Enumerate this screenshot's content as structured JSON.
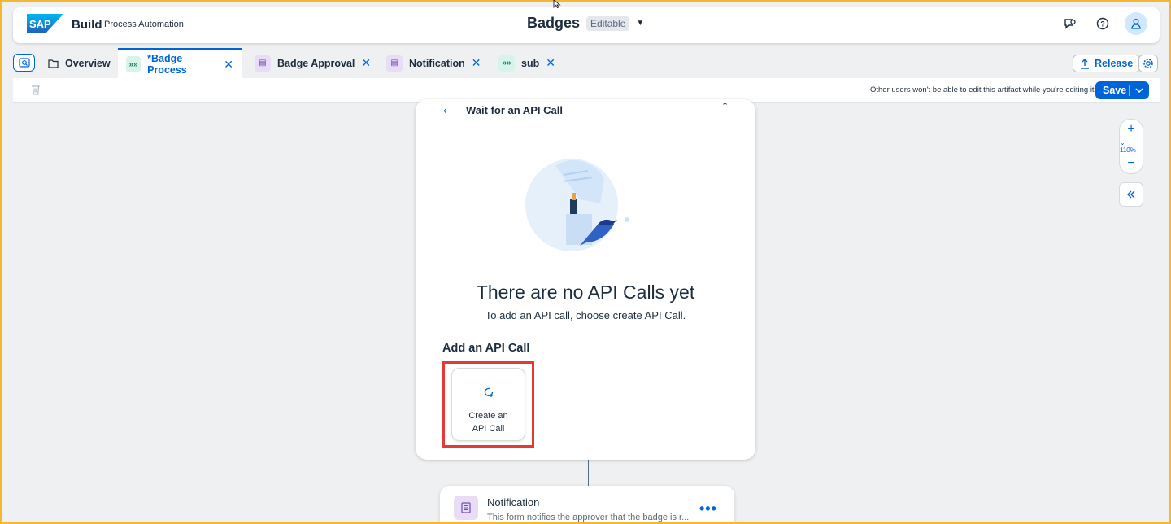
{
  "app": {
    "brand_build": "Build",
    "brand_sub": "Process Automation",
    "title": "Badges",
    "status_badge": "Editable"
  },
  "tabs": [
    {
      "label": "Overview",
      "icon": "folder-icon",
      "active": false
    },
    {
      "label": "*Badge Process",
      "icon": "process-icon",
      "active": true
    },
    {
      "label": "Badge Approval",
      "icon": "form-icon",
      "active": false
    },
    {
      "label": "Notification",
      "icon": "form-icon",
      "active": false
    },
    {
      "label": "sub",
      "icon": "process-icon",
      "active": false
    }
  ],
  "actions": {
    "release_label": "Release",
    "save_label": "Save",
    "edit_note": "Other users won't be able to edit this artifact while you're editing it."
  },
  "zoom": {
    "level": "110%"
  },
  "panel": {
    "title": "Wait for an API Call",
    "empty_title": "There are no API Calls yet",
    "empty_subtitle": "To add an API call, choose create API Call.",
    "section_title": "Add an API Call",
    "create_label_line1": "Create an",
    "create_label_line2": "API Call"
  },
  "node": {
    "title": "Notification",
    "description": "This form notifies the approver that the badge is r..."
  },
  "colors": {
    "accent": "#0064d9",
    "highlight": "#e53935",
    "frame": "#f5b731"
  }
}
